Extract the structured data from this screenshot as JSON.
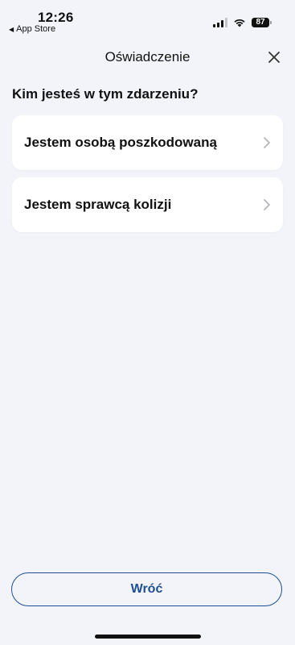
{
  "status_bar": {
    "time": "12:26",
    "back_app": "App Store",
    "battery": "87"
  },
  "nav": {
    "title": "Oświadczenie",
    "close_icon": "close-icon"
  },
  "question": "Kim jesteś w tym zdarzeniu?",
  "options": [
    {
      "label": "Jestem osobą poszkodowaną",
      "icon": "chevron-right-icon"
    },
    {
      "label": "Jestem sprawcą kolizji",
      "icon": "chevron-right-icon"
    }
  ],
  "footer": {
    "back_label": "Wróć"
  },
  "colors": {
    "background": "#f3f4f9",
    "accent": "#1d4f91",
    "card": "#ffffff"
  }
}
